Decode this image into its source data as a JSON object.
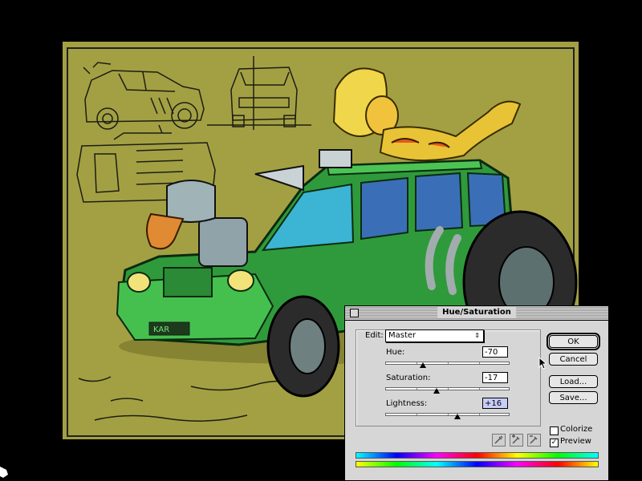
{
  "dialog": {
    "title": "Hue/Saturation",
    "edit_label": "Edit:",
    "edit_value": "Master",
    "popup_arrows": "⇕",
    "sliders": [
      {
        "label": "Hue:",
        "value": "-70",
        "position": 0.306
      },
      {
        "label": "Saturation:",
        "value": "-17",
        "position": 0.415
      },
      {
        "label": "Lightness:",
        "value": "+16",
        "position": 0.58
      }
    ],
    "buttons": {
      "ok": "OK",
      "cancel": "Cancel",
      "load": "Load...",
      "save": "Save..."
    },
    "colorize": {
      "label": "Colorize",
      "checked": false
    },
    "preview": {
      "label": "Preview",
      "checked": true,
      "mark": "✓"
    }
  },
  "icons": [
    "close-icon",
    "eyedropper-icon",
    "eyedropper-plus-icon",
    "eyedropper-minus-icon",
    "arrow-cursor-icon"
  ],
  "colors": {
    "canvas_background": "#a3a044",
    "car_green": "#3fa84a",
    "dialog_background": "#d6d6d6",
    "lightness_field_highlight": "#c8cdfa"
  }
}
